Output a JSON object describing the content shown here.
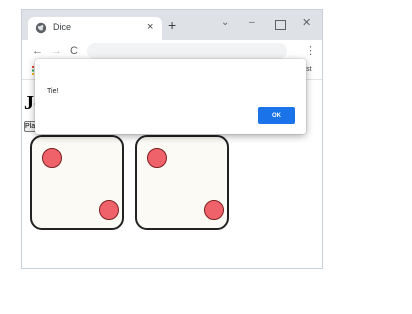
{
  "browser": {
    "tab_title": "Dice",
    "new_tab_symbol": "+",
    "tab_close_symbol": "×",
    "window_controls": {
      "dropdown": "⌄",
      "minimize": "–",
      "close": "✕"
    },
    "nav": {
      "back": "←",
      "forward": "→",
      "reload": "C"
    },
    "menu_symbol": "⋮",
    "bookmarks_other": "list"
  },
  "page": {
    "heading": "Jo",
    "play_button_label": "Play"
  },
  "dialog": {
    "message": "Tie!",
    "ok_label": "OK",
    "ok_color": "#1a73e8"
  },
  "dice": [
    {
      "value": 2,
      "pip_color": "#f0626a"
    },
    {
      "value": 2,
      "pip_color": "#f0626a"
    }
  ]
}
